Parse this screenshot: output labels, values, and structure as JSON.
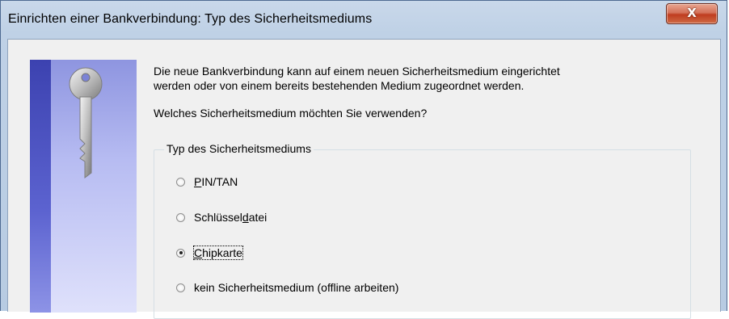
{
  "window": {
    "title": "Einrichten einer Bankverbindung: Typ des Sicherheitsmediums",
    "close_label": "X"
  },
  "content": {
    "intro_line1": "Die neue Bankverbindung kann  auf einem neuen Sicherheitsmedium eingerichtet",
    "intro_line2": "werden oder von einem bereits bestehenden Medium zugeordnet werden.",
    "question": "Welches Sicherheitsmedium möchten Sie verwenden?",
    "group_title": "Typ des Sicherheitsmediums"
  },
  "options": [
    {
      "pre": "",
      "accel": "P",
      "post": "IN/TAN",
      "checked": false
    },
    {
      "pre": "Schlüssel",
      "accel": "d",
      "post": "atei",
      "checked": false
    },
    {
      "pre": "",
      "accel": "C",
      "post": "hipkarte",
      "checked": true
    },
    {
      "pre": "kein Sicherheitsmedium (offline arbeiten)",
      "accel": "",
      "post": "",
      "checked": false
    }
  ],
  "icons": {
    "side_image": "key-icon",
    "close": "close-icon"
  },
  "colors": {
    "title_bar": "#bfd1e6",
    "close_button": "#c9472a",
    "dialog_bg": "#f0f0f0",
    "side_panel": "#5c63d0"
  }
}
